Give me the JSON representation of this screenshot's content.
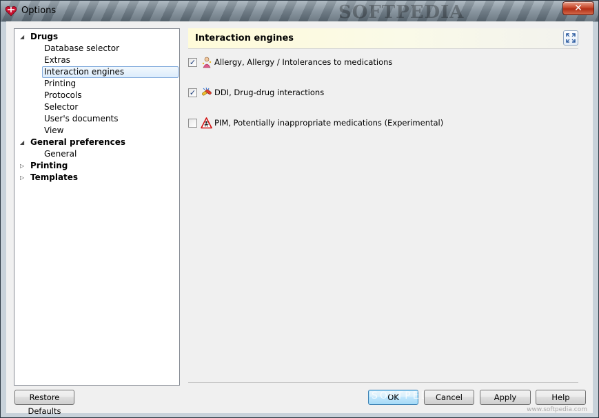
{
  "window": {
    "title": "Options",
    "title_watermark": "SOFTPEDIA",
    "close_label": "✕"
  },
  "tree": {
    "groups": [
      {
        "label": "Drugs",
        "expanded": true,
        "children": [
          "Database selector",
          "Extras",
          "Interaction engines",
          "Printing",
          "Protocols",
          "Selector",
          "User's documents",
          "View"
        ]
      },
      {
        "label": "General preferences",
        "expanded": true,
        "children": [
          "General"
        ]
      },
      {
        "label": "Printing",
        "expanded": false,
        "children": []
      },
      {
        "label": "Templates",
        "expanded": false,
        "children": []
      }
    ],
    "selected": "Interaction engines",
    "arrow_expanded": "◢",
    "arrow_collapsed": "▷"
  },
  "panel": {
    "title": "Interaction engines",
    "options": [
      {
        "label": "Allergy, Allergy / Intolerances to medications",
        "checked": true,
        "icon": "allergy-icon"
      },
      {
        "label": "DDI, Drug-drug interactions",
        "checked": true,
        "icon": "ddi-icon"
      },
      {
        "label": "PIM, Potentially inappropriate medications (Experimental)",
        "checked": false,
        "icon": "pim-warning-icon"
      }
    ]
  },
  "buttons": {
    "restore_defaults": "Restore Defaults",
    "ok": "OK",
    "cancel": "Cancel",
    "apply": "Apply",
    "help": "Help"
  },
  "watermarks": {
    "buttons_overlay": "SOFTPEDIA",
    "footer": "www.softpedia.com"
  },
  "colors": {
    "header_gradient_start": "#fffbd9",
    "selection_border": "#84acdd",
    "default_button": "#bee6fd"
  }
}
